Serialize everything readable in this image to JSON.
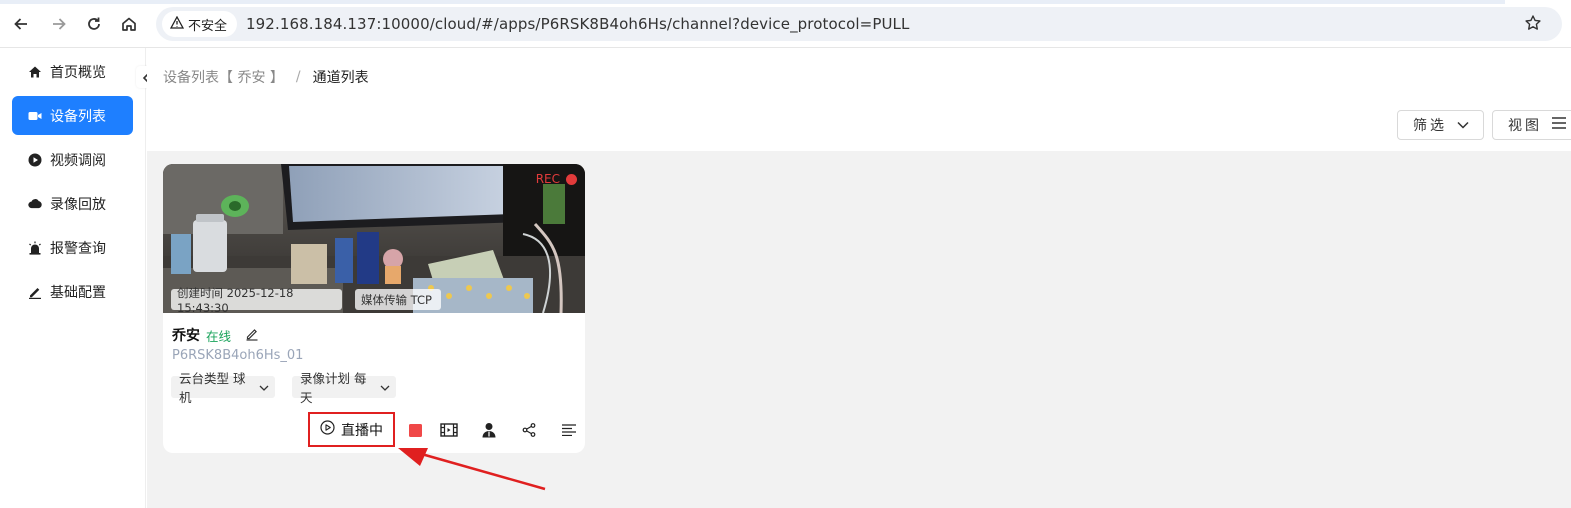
{
  "browser": {
    "security_label": "不安全",
    "url": "192.168.184.137:10000/cloud/#/apps/P6RSK8B4oh6Hs/channel?device_protocol=PULL"
  },
  "sidebar": {
    "items": [
      {
        "label": "首页概览",
        "icon": "home-icon",
        "active": false
      },
      {
        "label": "设备列表",
        "icon": "camera-icon",
        "active": true
      },
      {
        "label": "视频调阅",
        "icon": "play-circle-icon",
        "active": false
      },
      {
        "label": "录像回放",
        "icon": "cloud-icon",
        "active": false
      },
      {
        "label": "报警查询",
        "icon": "alarm-icon",
        "active": false
      },
      {
        "label": "基础配置",
        "icon": "edit-icon",
        "active": false
      }
    ]
  },
  "breadcrumb": {
    "parent": "设备列表【 乔安 】",
    "separator": "/",
    "current": "通道列表"
  },
  "toolbar": {
    "filter_label": "筛选",
    "view_label": "视图"
  },
  "card": {
    "rec_label": "REC",
    "created_tag": "创建时间 2025-12-18 15:43:30",
    "transport_tag": "媒体传输 TCP",
    "name": "乔安",
    "status": "在线",
    "channel_id": "P6RSK8B4oh6Hs_01",
    "ptz_label": "云台类型 球机",
    "record_plan_label": "录像计划 每天",
    "live_label": "直播中"
  },
  "colors": {
    "accent": "#1e7fff",
    "online": "#19a35b",
    "highlight": "#e02020",
    "rec": "#e23b3b"
  }
}
